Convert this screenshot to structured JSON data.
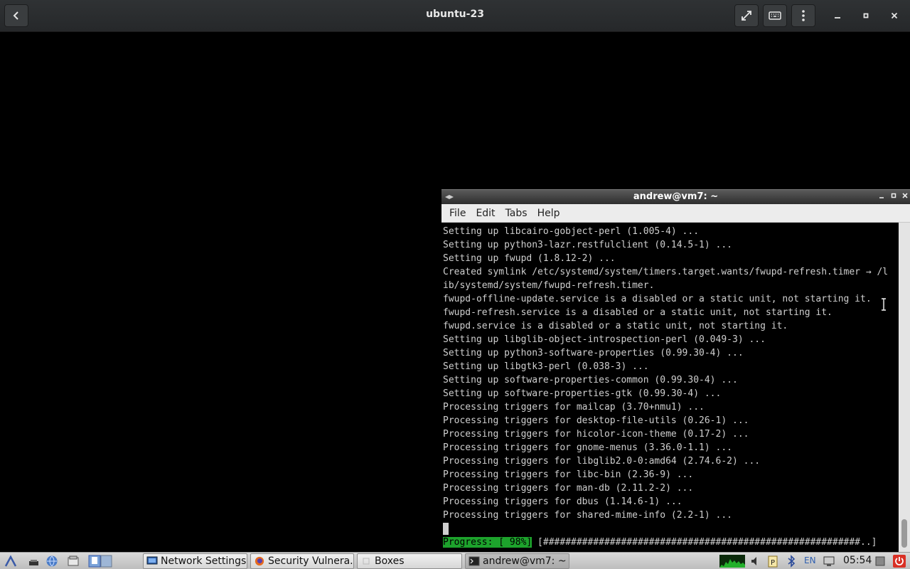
{
  "header": {
    "title": "ubuntu-23",
    "icons": {
      "back": "back-arrow-icon",
      "fullscreen": "fullscreen-icon",
      "keyboard": "keyboard-icon",
      "menu": "kebab-menu-icon",
      "minimize": "minimize-icon",
      "maximize": "maximize-icon",
      "close": "close-icon"
    }
  },
  "terminal": {
    "title": "andrew@vm7: ~",
    "menu": [
      "File",
      "Edit",
      "Tabs",
      "Help"
    ],
    "lines": [
      "Setting up libcairo-gobject-perl (1.005-4) ...",
      "Setting up python3-lazr.restfulclient (0.14.5-1) ...",
      "Setting up fwupd (1.8.12-2) ...",
      "Created symlink /etc/systemd/system/timers.target.wants/fwupd-refresh.timer → /l",
      "ib/systemd/system/fwupd-refresh.timer.",
      "fwupd-offline-update.service is a disabled or a static unit, not starting it.",
      "fwupd-refresh.service is a disabled or a static unit, not starting it.",
      "fwupd.service is a disabled or a static unit, not starting it.",
      "Setting up libglib-object-introspection-perl (0.049-3) ...",
      "Setting up python3-software-properties (0.99.30-4) ...",
      "Setting up libgtk3-perl (0.038-3) ...",
      "Setting up software-properties-common (0.99.30-4) ...",
      "Setting up software-properties-gtk (0.99.30-4) ...",
      "Processing triggers for mailcap (3.70+nmu1) ...",
      "Processing triggers for desktop-file-utils (0.26-1) ...",
      "Processing triggers for hicolor-icon-theme (0.17-2) ...",
      "Processing triggers for gnome-menus (3.36.0-1.1) ...",
      "Processing triggers for libglib2.0-0:amd64 (2.74.6-2) ...",
      "Processing triggers for libc-bin (2.36-9) ...",
      "Processing triggers for man-db (2.11.2-2) ...",
      "Processing triggers for dbus (1.14.6-1) ...",
      "Processing triggers for shared-mime-info (2.2-1) ..."
    ],
    "progress_label": "Progress: [ 98%]",
    "progress_bar": " [#########################################################..]",
    "progress_percent": 98
  },
  "taskbar": {
    "tasks": [
      {
        "label": "Network Settings",
        "icon": "network-settings-icon"
      },
      {
        "label": "Security Vulnera...",
        "icon": "firefox-icon"
      },
      {
        "label": "Boxes",
        "icon": "boxes-icon"
      },
      {
        "label": "andrew@vm7: ~",
        "icon": "terminal-icon"
      }
    ],
    "language": "EN",
    "clock": "05:54",
    "colors": {
      "accent_green": "#1da32c",
      "power_red": "#d93025"
    }
  }
}
